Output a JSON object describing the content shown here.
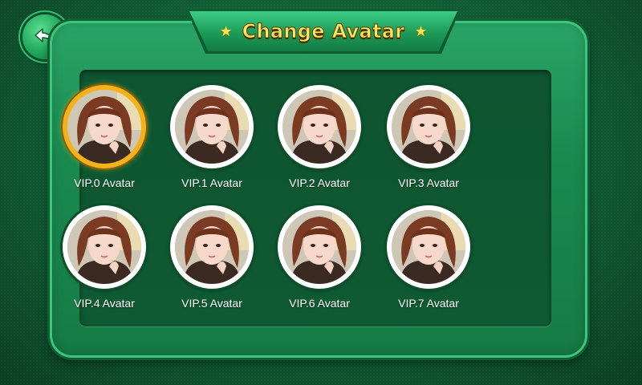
{
  "header": {
    "title": "Change Avatar"
  },
  "avatars": [
    {
      "label": "VIP.0 Avatar",
      "selected": true
    },
    {
      "label": "VIP.1 Avatar",
      "selected": false
    },
    {
      "label": "VIP.2 Avatar",
      "selected": false
    },
    {
      "label": "VIP.3 Avatar",
      "selected": false
    },
    {
      "label": "VIP.4 Avatar",
      "selected": false
    },
    {
      "label": "VIP.5 Avatar",
      "selected": false
    },
    {
      "label": "VIP.6 Avatar",
      "selected": false
    },
    {
      "label": "VIP.7 Avatar",
      "selected": false
    }
  ],
  "icons": {
    "back": "back-arrow-icon",
    "title_star": "star-icon"
  },
  "colors": {
    "background": "#115b33",
    "panel": "#1a8a4f",
    "title_text": "#ffe761",
    "selected_ring": "#f3b21b"
  }
}
